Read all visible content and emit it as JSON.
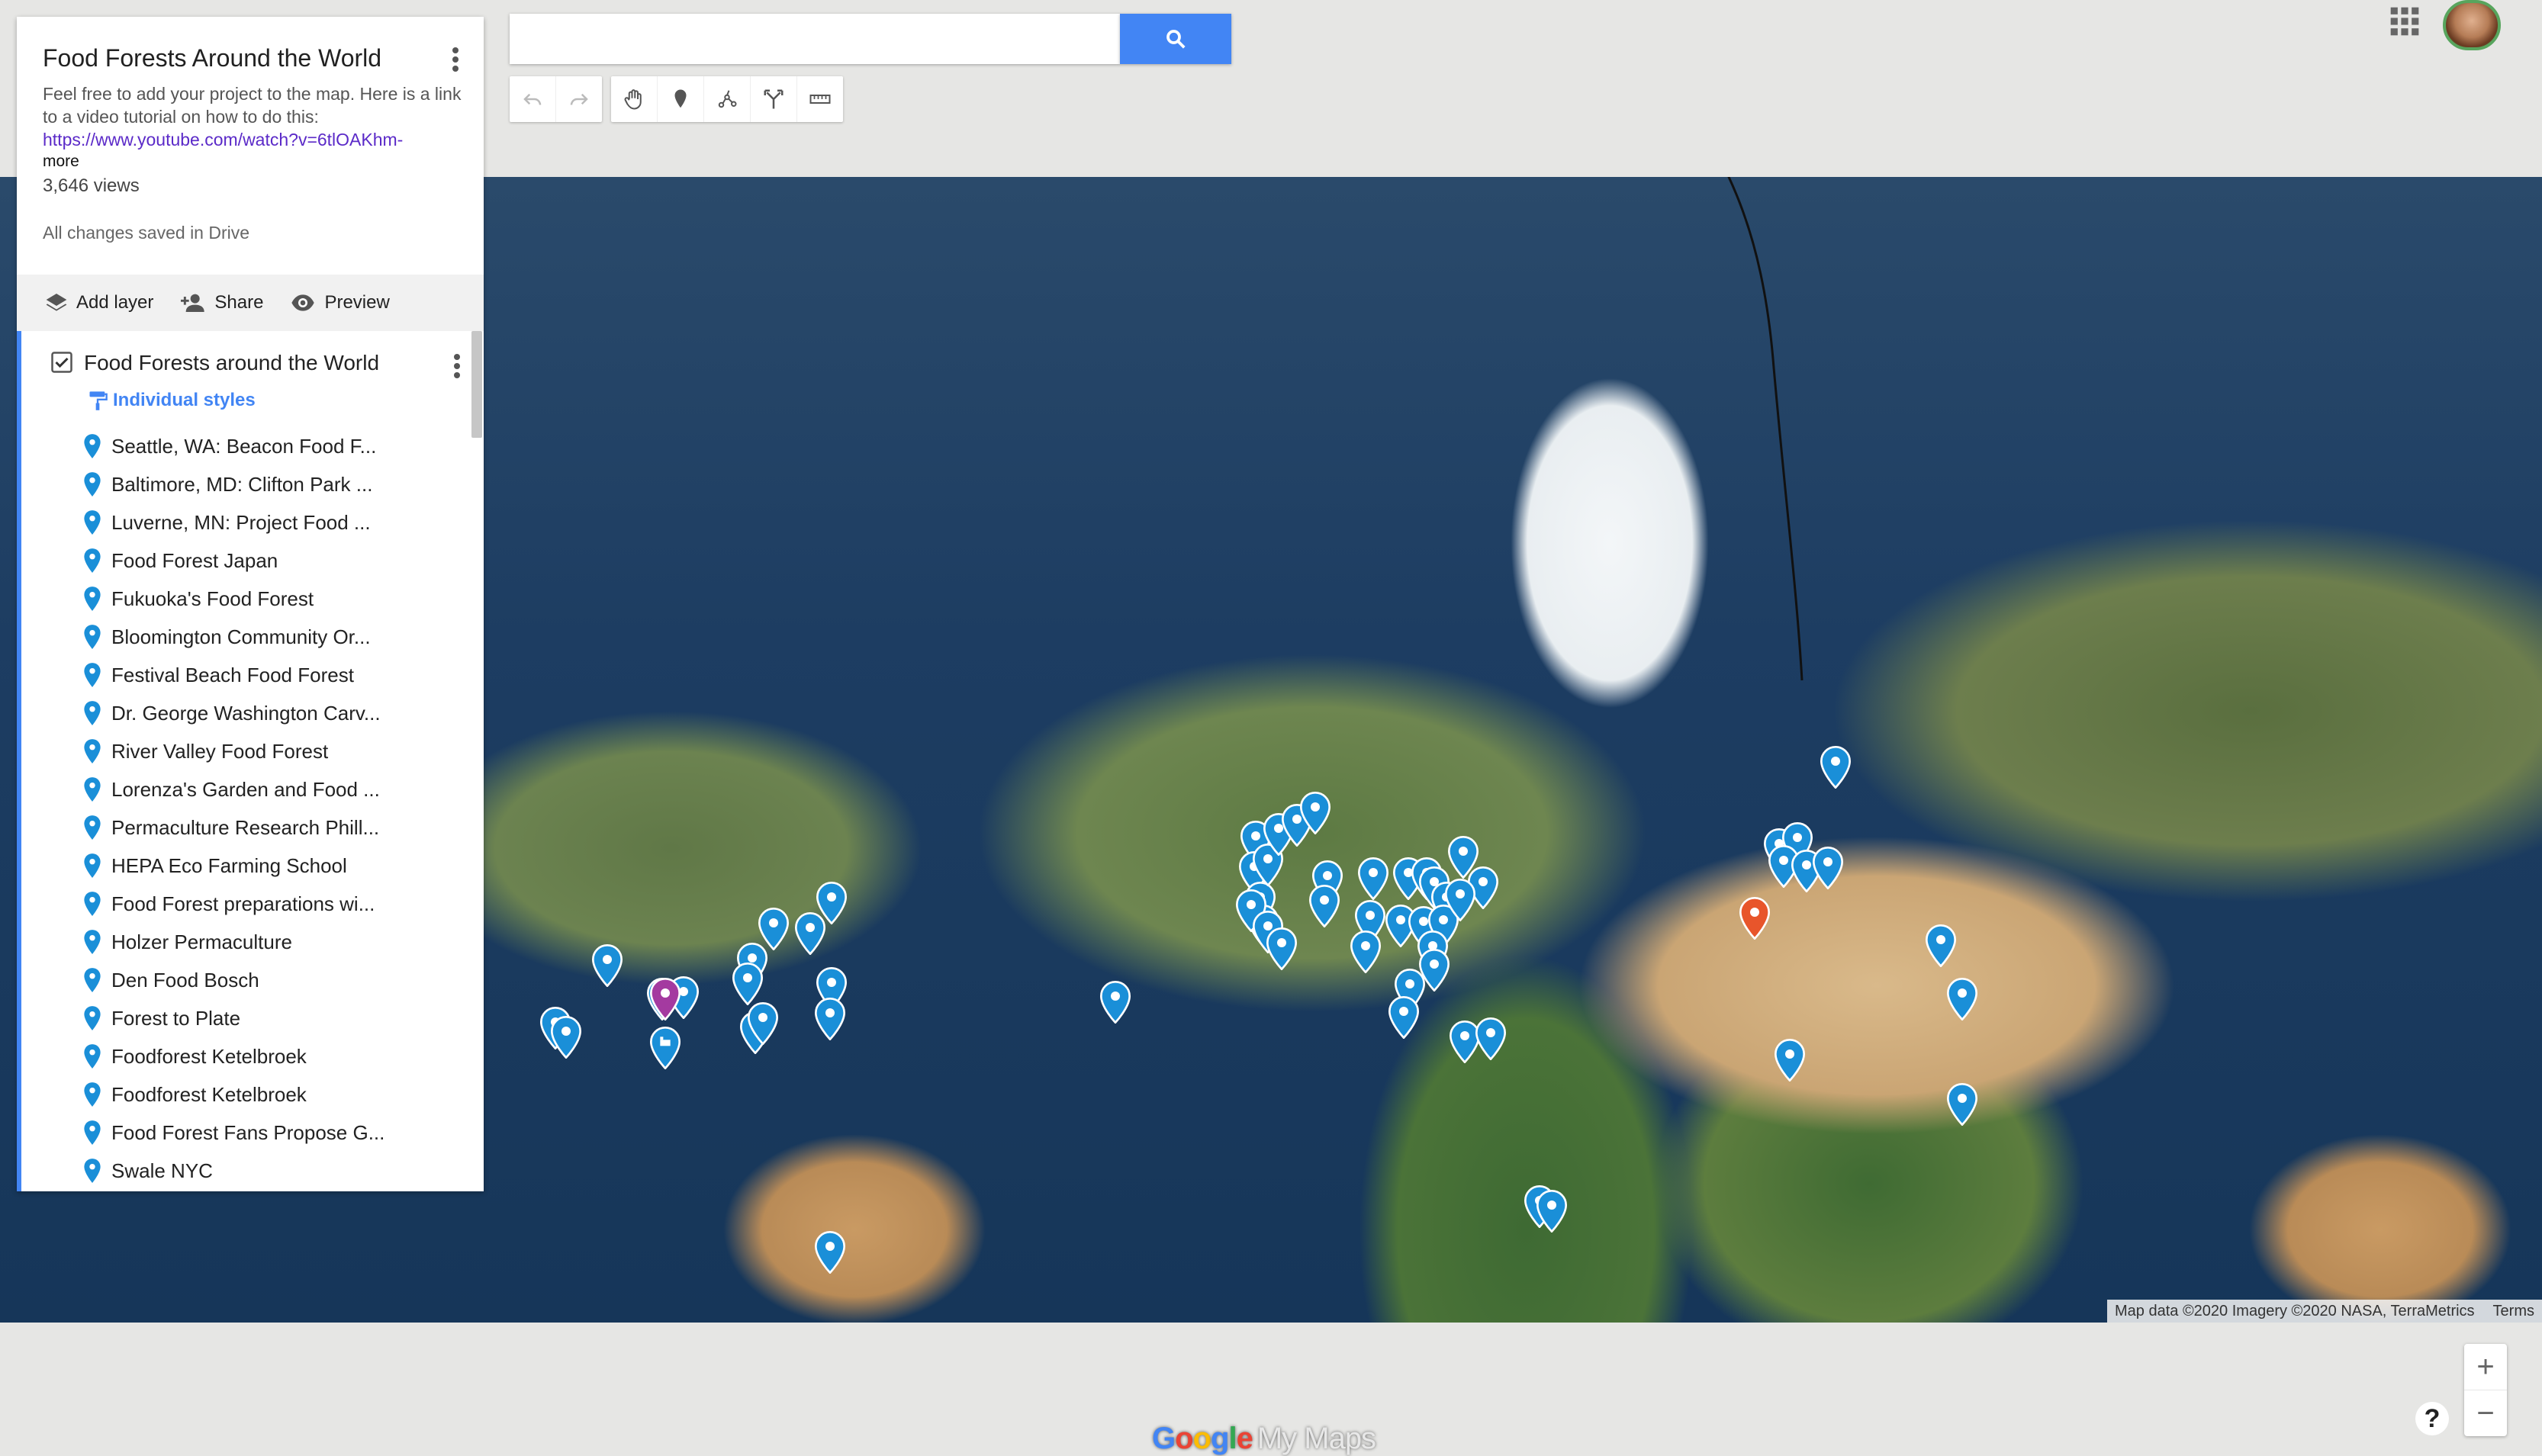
{
  "map": {
    "title": "Food Forests Around the World",
    "description": "Feel free to add your project to the map. Here is a link to a video tutorial on how to do this:",
    "link": "https://www.youtube.com/watch?v=6tlOAKhm-",
    "more": "more",
    "views": "3,646 views",
    "save_status": "All changes saved in Drive"
  },
  "actions": {
    "add_layer": "Add layer",
    "share": "Share",
    "preview": "Preview"
  },
  "layer": {
    "title": "Food Forests around the World",
    "style_link": "Individual styles",
    "items": [
      "Seattle, WA:  Beacon Food F...",
      "Baltimore, MD:  Clifton Park ...",
      "Luverne, MN:  Project Food ...",
      "Food Forest Japan",
      "Fukuoka's Food Forest",
      "Bloomington Community Or...",
      "Festival Beach Food Forest",
      "Dr. George Washington Carv...",
      "River Valley Food Forest",
      "Lorenza's Garden and Food ...",
      "Permaculture Research Phill...",
      "HEPA Eco Farming School",
      "Food Forest preparations wi...",
      "Holzer Permaculture",
      "Den Food Bosch",
      "Forest to Plate",
      "Foodforest Ketelbroek",
      "Foodforest Ketelbroek",
      "Food Forest Fans Propose G...",
      "Swale NYC"
    ]
  },
  "search": {
    "placeholder": ""
  },
  "branding": {
    "google": [
      "G",
      "o",
      "o",
      "g",
      "l",
      "e"
    ],
    "mymaps": "My Maps"
  },
  "attribution": {
    "data": "Map data ©2020 Imagery ©2020 NASA, TerraMetrics",
    "terms": "Terms"
  },
  "controls": {
    "zoom_in": "+",
    "zoom_out": "−",
    "help": "?"
  },
  "colors": {
    "pin_default": "#1a8fd8",
    "pin_selected": "#e8552b",
    "pin_purple": "#a43aa0",
    "accent": "#4285f4"
  }
}
